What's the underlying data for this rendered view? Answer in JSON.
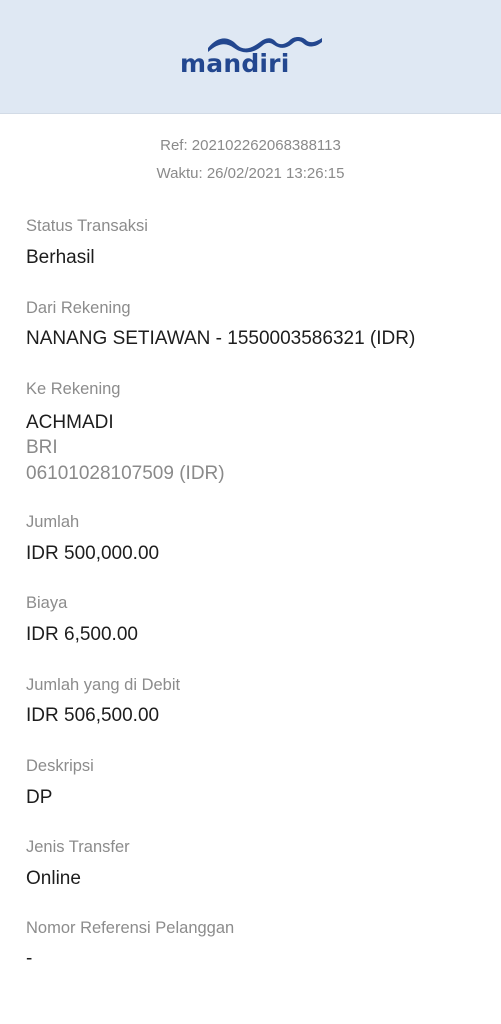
{
  "brand": {
    "name": "mandiri",
    "wave_color": "#23478f",
    "header_bg": "#dfe8f3"
  },
  "receipt": {
    "ref": "Ref: 202102262068388113",
    "time": "Waktu: 26/02/2021 13:26:15"
  },
  "fields": {
    "status": {
      "label": "Status Transaksi",
      "value": "Berhasil"
    },
    "from": {
      "label": "Dari Rekening",
      "value": "NANANG SETIAWAN - 1550003586321 (IDR)"
    },
    "to": {
      "label": "Ke Rekening",
      "name": "ACHMADI",
      "bank": "BRI",
      "account": "06101028107509 (IDR)"
    },
    "amount": {
      "label": "Jumlah",
      "value": "IDR 500,000.00"
    },
    "fee": {
      "label": "Biaya",
      "value": "IDR 6,500.00"
    },
    "debited": {
      "label": "Jumlah yang di Debit",
      "value": "IDR 506,500.00"
    },
    "description": {
      "label": "Deskripsi",
      "value": "DP"
    },
    "transfer_type": {
      "label": "Jenis Transfer",
      "value": "Online"
    },
    "customer_ref": {
      "label": "Nomor Referensi Pelanggan",
      "value": "-"
    }
  }
}
